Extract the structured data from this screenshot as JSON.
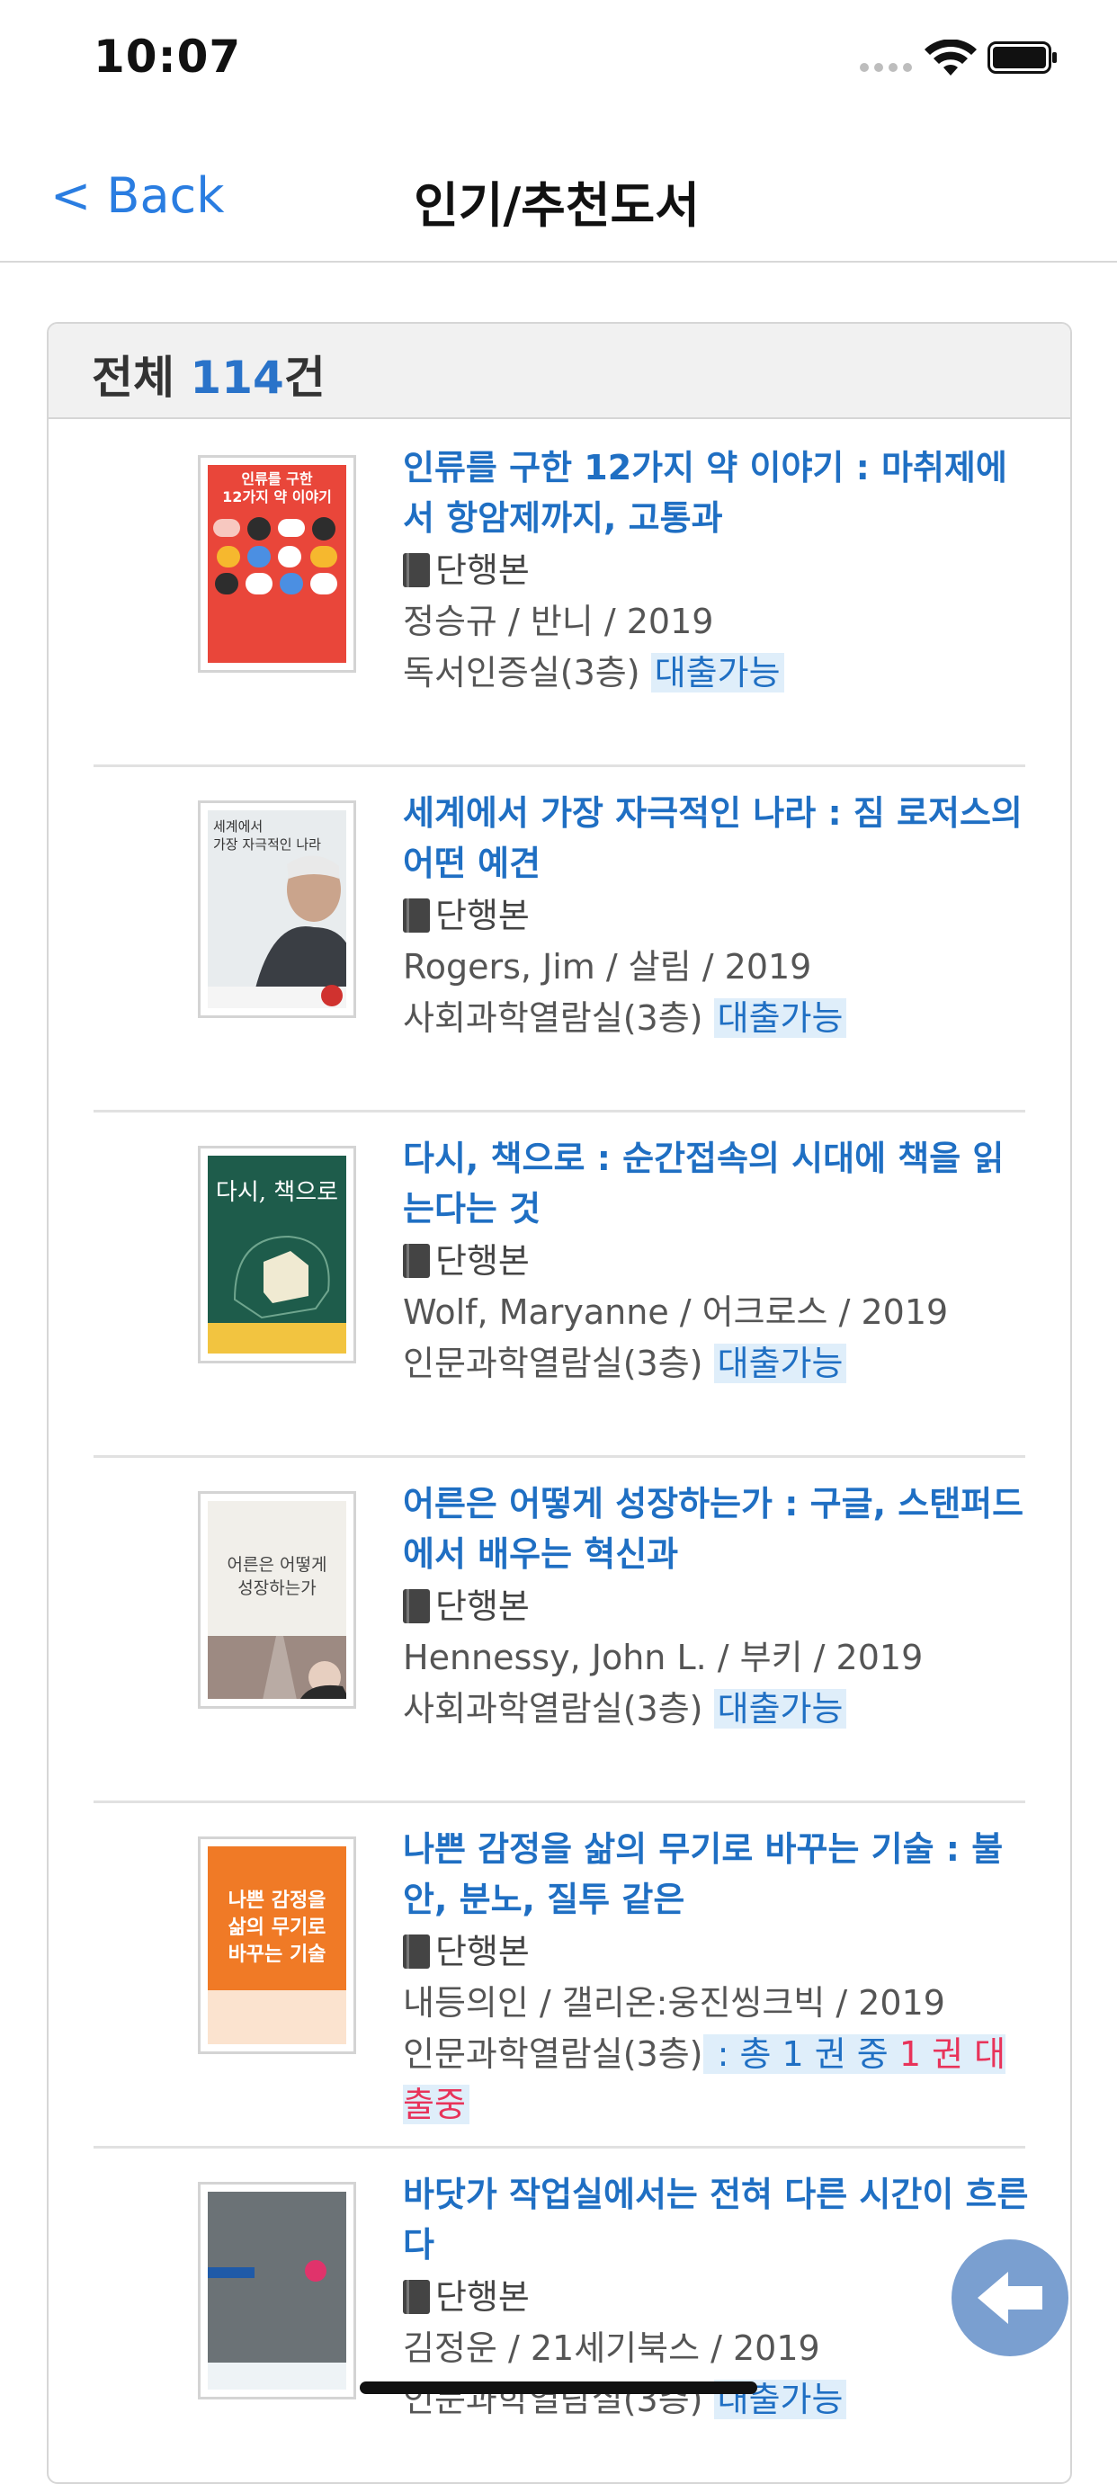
{
  "status_bar": {
    "time": "10:07"
  },
  "nav": {
    "back_label": "< Back",
    "title": "인기/추천도서"
  },
  "summary": {
    "prefix": "전체 ",
    "count": "114",
    "suffix": "건"
  },
  "books": [
    {
      "title": "인류를 구한 12가지 약 이야기 : 마취제에서 항암제까지, 고통과",
      "format": "단행본",
      "meta": "정승규 /  반니 /  2019",
      "location": "독서인증실(3층)",
      "status": "대출가능",
      "cover": {
        "bg": "#e9463a",
        "text_color": "#ffffff",
        "lines": [
          "인류를 구한",
          "12가지 약 이야기"
        ]
      }
    },
    {
      "title": "세계에서 가장 자극적인 나라 : 짐 로저스의 어떤 예견",
      "format": "단행본",
      "meta": "Rogers, Jim /  살림 /  2019",
      "location": "사회과학열람실(3층)",
      "status": "대출가능",
      "cover": {
        "bg": "#e8ecee",
        "text_color": "#333333",
        "lines": [
          "세계에서",
          "가장 자극적인 나라"
        ]
      }
    },
    {
      "title": "다시, 책으로 : 순간접속의 시대에 책을 읽는다는 것",
      "format": "단행본",
      "meta": "Wolf, Maryanne /  어크로스 /  2019",
      "location": "인문과학열람실(3층)",
      "status": "대출가능",
      "cover": {
        "bg": "#1e5c4b",
        "text_color": "#ffffff",
        "lines": [
          "다시, 책으로"
        ]
      }
    },
    {
      "title": "어른은 어떻게 성장하는가 : 구글, 스탠퍼드에서 배우는 혁신과",
      "format": "단행본",
      "meta": "Hennessy, John L. /  부키 /  2019",
      "location": "사회과학열람실(3층)",
      "status": "대출가능",
      "cover": {
        "bg": "#f1efea",
        "text_color": "#444444",
        "lines": [
          "어른은 어떻게",
          "성장하는가"
        ]
      }
    },
    {
      "title": "나쁜 감정을 삶의 무기로 바꾸는 기술 : 불안, 분노, 질투 같은",
      "format": "단행본",
      "meta": "내등의인 /  갤리온:웅진씽크빅 /  2019",
      "location": "인문과학열람실(3층)",
      "status_prefix": " : 총 1 권 중 ",
      "status_loaned": "1 권 대출중",
      "cover": {
        "bg": "#f07a26",
        "text_color": "#ffffff",
        "lines": [
          "나쁜 감정을",
          "삶의 무기로",
          "바꾸는 기술"
        ]
      }
    },
    {
      "title": "바닷가 작업실에서는 전혀 다른 시간이 흐른다",
      "format": "단행본",
      "meta": "김정운 /  21세기북스 /  2019",
      "location": "인문과학열람실(3층)",
      "status": "대출가능",
      "cover": {
        "bg": "#6c7378",
        "text_color": "#ffffff",
        "lines": []
      }
    }
  ],
  "colors": {
    "link": "#1f6fc3",
    "accent": "#2a7de1",
    "loaned": "#e8335a",
    "avail_bg": "#dfeefa",
    "fab": "#7a9fd0"
  },
  "icons": {
    "format": "book-icon",
    "fab": "back-arrow-icon"
  }
}
